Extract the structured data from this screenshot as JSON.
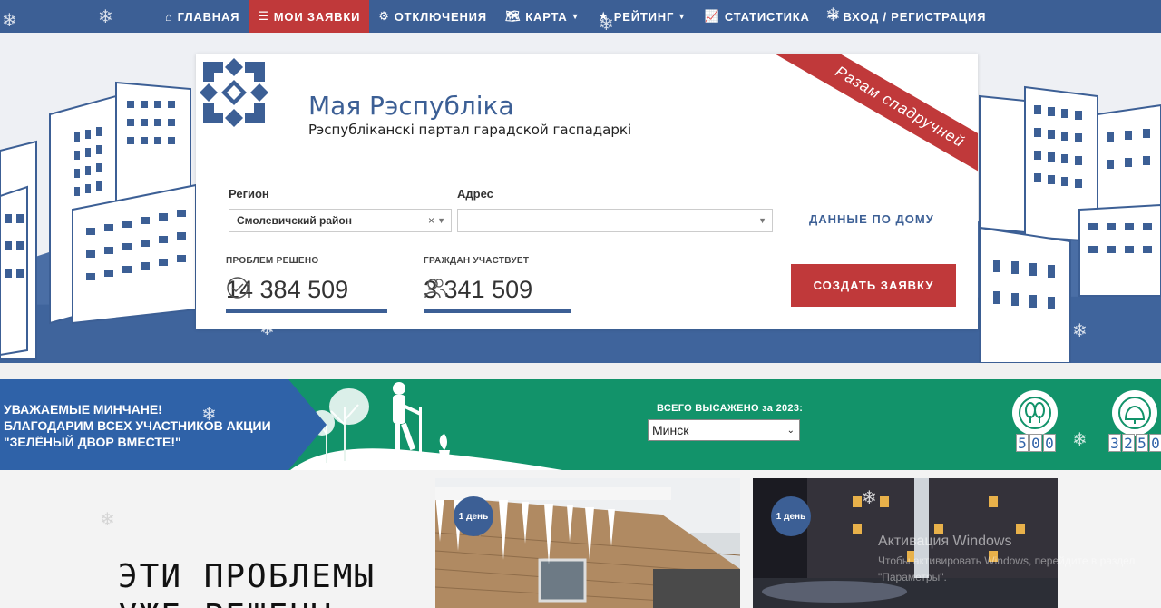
{
  "nav": {
    "items": [
      {
        "icon": "home-icon",
        "glyph": "⌂",
        "label": "ГЛАВНАЯ",
        "caret": false,
        "active": false
      },
      {
        "icon": "list-icon",
        "glyph": "☰",
        "label": "МОИ ЗАЯВКИ",
        "caret": false,
        "active": true
      },
      {
        "icon": "gear-icon",
        "glyph": "⚙",
        "label": "ОТКЛЮЧЕНИЯ",
        "caret": false,
        "active": false
      },
      {
        "icon": "map-icon",
        "glyph": "🗺",
        "label": "КАРТА",
        "caret": true,
        "active": false
      },
      {
        "icon": "star-icon",
        "glyph": "★",
        "label": "РЕЙТИНГ",
        "caret": true,
        "active": false
      },
      {
        "icon": "chart-icon",
        "glyph": "📈",
        "label": "СТАТИСТИКА",
        "caret": false,
        "active": false
      },
      {
        "icon": "login-icon",
        "glyph": "⇥",
        "label": "ВХОД / РЕГИСТРАЦИЯ",
        "caret": false,
        "active": false
      }
    ]
  },
  "brand": {
    "title": "Мая Рэспубліка",
    "subtitle": "Рэспубліканскі партал гарадской гаспадаркі",
    "ribbon": "Разам спадручней"
  },
  "form": {
    "region_label": "Регион",
    "region_value": "Смолевичский район",
    "address_label": "Адрес",
    "address_value": "",
    "house_data_link": "ДАННЫЕ ПО ДОМУ",
    "create_button": "СОЗДАТЬ ЗАЯВКУ"
  },
  "stats": {
    "solved_label": "ПРОБЛЕМ РЕШЕНО",
    "solved_value": "14 384 509",
    "citizens_label": "ГРАЖДАН УЧАСТВУЕТ",
    "citizens_value": "3 341 509"
  },
  "banner": {
    "line1": "УВАЖАЕМЫЕ МИНЧАНЕ!",
    "line2": "БЛАГОДАРИМ ВСЕХ УЧАСТНИКОВ АКЦИИ",
    "line3": "\"ЗЕЛЁНЫЙ ДВОР ВМЕСТЕ!\"",
    "planted_label": "ВСЕГО ВЫСАЖЕНО за 2023:",
    "city": "Минск",
    "counter1": [
      "5",
      "0",
      "0"
    ],
    "counter2": [
      "3",
      "2",
      "5",
      "0"
    ]
  },
  "problems": {
    "title_line1": "ЭТИ ПРОБЛЕМЫ",
    "title_line2": "УЖЕ РЕШЕНЫ",
    "card1_badge": "1 день",
    "card2_badge": "1 день"
  },
  "watermark": {
    "line1": "Активация Windows",
    "line2": "Чтобы активировать Windows, перейдите в раздел",
    "line3": "\"Параметры\"."
  },
  "colors": {
    "nav": "#3c5f95",
    "accent_red": "#c0393a",
    "banner_green": "#12936a",
    "banner_blue": "#2f62a8"
  }
}
